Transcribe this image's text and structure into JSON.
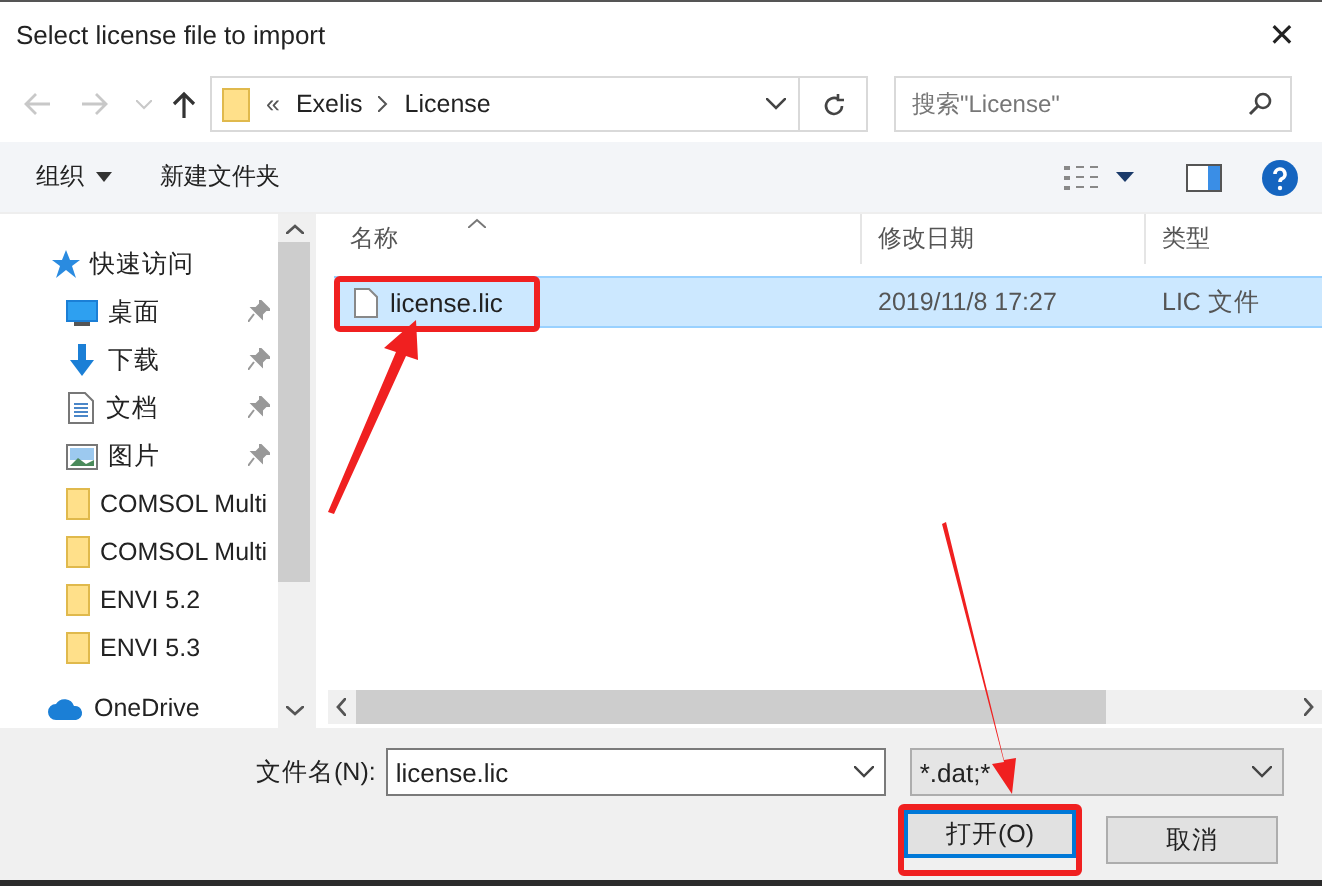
{
  "window": {
    "title": "Select license file to import",
    "close": "✕"
  },
  "nav": {
    "back_disabled": true,
    "forward_disabled": true,
    "path_prefix": "«",
    "path": [
      "Exelis",
      "License"
    ],
    "search_placeholder": "搜索\"License\""
  },
  "toolbar": {
    "organize": "组织",
    "new_folder": "新建文件夹"
  },
  "sidebar": {
    "items": [
      {
        "label": "快速访问",
        "kind": "quick",
        "children": [
          {
            "label": "桌面",
            "kind": "desktop",
            "pinned": true
          },
          {
            "label": "下载",
            "kind": "download",
            "pinned": true
          },
          {
            "label": "文档",
            "kind": "docs",
            "pinned": true
          },
          {
            "label": "图片",
            "kind": "pics",
            "pinned": true
          },
          {
            "label": "COMSOL Multi",
            "kind": "folder",
            "pinned": false
          },
          {
            "label": "COMSOL Multi",
            "kind": "folder",
            "pinned": false
          },
          {
            "label": "ENVI 5.2",
            "kind": "folder",
            "pinned": false
          },
          {
            "label": "ENVI 5.3",
            "kind": "folder",
            "pinned": false
          }
        ]
      },
      {
        "label": "OneDrive",
        "kind": "cloud"
      }
    ]
  },
  "table": {
    "columns": [
      "名称",
      "修改日期",
      "类型"
    ],
    "rows": [
      {
        "cells": [
          "license.lic",
          "2019/11/8 17:27",
          "LIC 文件"
        ],
        "selected": true,
        "annotated": true
      }
    ]
  },
  "footer": {
    "filename_label": "文件名(N):",
    "filename": "license.lic",
    "filter": "*.dat;*",
    "buttons": [
      {
        "label": "打开(O)",
        "default": true,
        "annotated": true
      },
      {
        "label": "取消",
        "default": false,
        "annotated": false
      }
    ]
  }
}
